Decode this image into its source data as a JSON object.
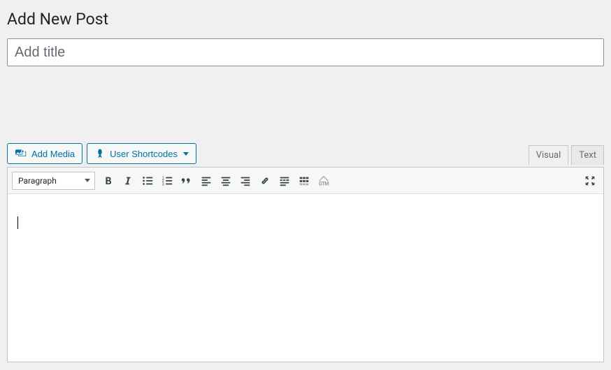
{
  "header": {
    "title": "Add New Post"
  },
  "title_field": {
    "placeholder": "Add title",
    "value": ""
  },
  "buttons": {
    "add_media": "Add Media",
    "user_shortcodes": "User Shortcodes"
  },
  "tabs": {
    "visual": "Visual",
    "text": "Text",
    "active": "visual"
  },
  "toolbar": {
    "format_dropdown": "Paragraph",
    "icons": [
      "bold",
      "italic",
      "ul",
      "ol",
      "quote",
      "align-left",
      "align-center",
      "align-right",
      "link",
      "more",
      "kitchen-sink",
      "gtm"
    ]
  },
  "editor": {
    "content": ""
  }
}
